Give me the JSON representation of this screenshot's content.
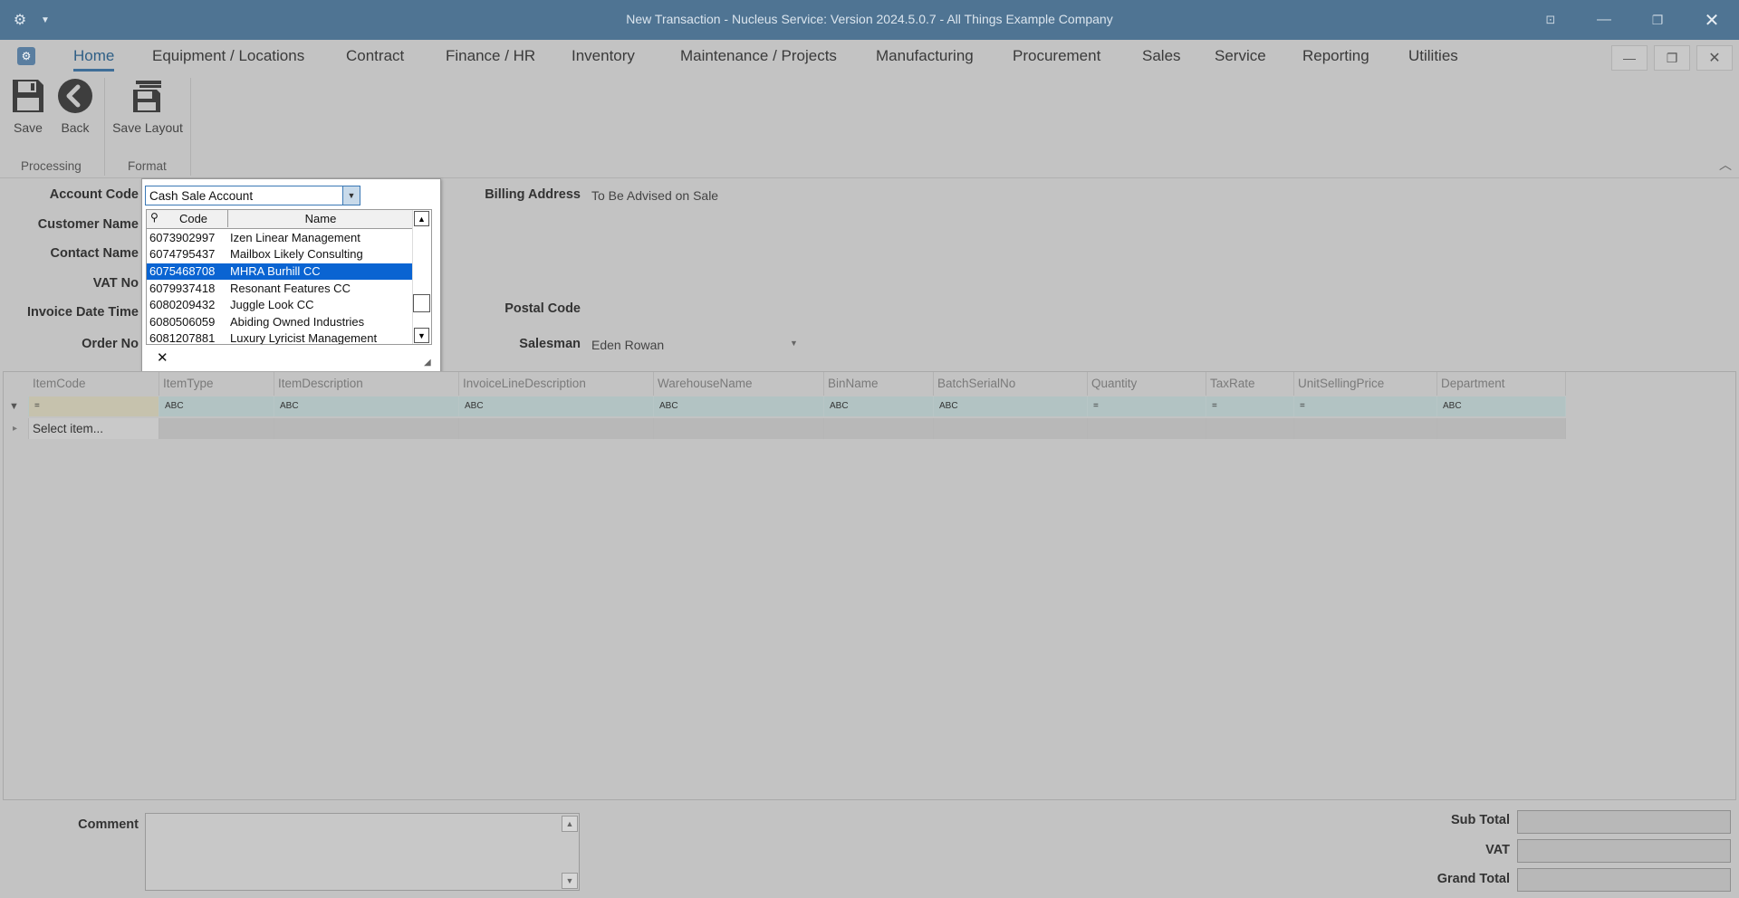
{
  "window": {
    "title": "New Transaction - Nucleus Service: Version 2024.5.0.7 - All Things Example Company"
  },
  "menu": {
    "tabs": [
      {
        "label": "Home"
      },
      {
        "label": "Equipment / Locations"
      },
      {
        "label": "Contract"
      },
      {
        "label": "Finance / HR"
      },
      {
        "label": "Inventory"
      },
      {
        "label": "Maintenance / Projects"
      },
      {
        "label": "Manufacturing"
      },
      {
        "label": "Procurement"
      },
      {
        "label": "Sales"
      },
      {
        "label": "Service"
      },
      {
        "label": "Reporting"
      },
      {
        "label": "Utilities"
      }
    ],
    "active": "Home"
  },
  "ribbon": {
    "save": "Save",
    "back": "Back",
    "save_layout": "Save Layout",
    "group_processing": "Processing",
    "group_format": "Format"
  },
  "form": {
    "account_code_label": "Account Code",
    "account_code_value": "Cash Sale Account",
    "customer_name_label": "Customer Name",
    "contact_name_label": "Contact Name",
    "vat_no_label": "VAT No",
    "invoice_dt_label": "Invoice Date Time",
    "order_no_label": "Order No",
    "billing_address_label": "Billing Address",
    "billing_address_value": "To Be Advised on Sale",
    "postal_code_label": "Postal Code",
    "salesman_label": "Salesman",
    "salesman_value": "Eden Rowan"
  },
  "lookup": {
    "col_code": "Code",
    "col_name": "Name",
    "rows": [
      {
        "code": "6073902997",
        "name": "Izen Linear Management"
      },
      {
        "code": "6074795437",
        "name": "Mailbox Likely Consulting"
      },
      {
        "code": "6075468708",
        "name": "MHRA Burhill CC"
      },
      {
        "code": "6079937418",
        "name": "Resonant Features CC"
      },
      {
        "code": "6080209432",
        "name": "Juggle Look CC"
      },
      {
        "code": "6080506059",
        "name": "Abiding Owned Industries"
      },
      {
        "code": "6081207881",
        "name": "Luxury Lyricist Management"
      }
    ],
    "selected_code": "6075468708"
  },
  "grid": {
    "columns": [
      "ItemCode",
      "ItemType",
      "ItemDescription",
      "InvoiceLineDescription",
      "WarehouseName",
      "BinName",
      "BatchSerialNo",
      "Quantity",
      "TaxRate",
      "UnitSellingPrice",
      "Department"
    ],
    "filter_symbols": [
      "=",
      "ABC",
      "ABC",
      "ABC",
      "ABC",
      "ABC",
      "ABC",
      "=",
      "=",
      "=",
      "ABC"
    ],
    "new_row_placeholder": "Select item..."
  },
  "footer": {
    "comment_label": "Comment",
    "sub_total_label": "Sub Total",
    "vat_label": "VAT",
    "grand_total_label": "Grand Total"
  },
  "colors": {
    "titlebar": "#4f7493",
    "selection": "#0a64d2",
    "background": "#c3c3c3"
  }
}
